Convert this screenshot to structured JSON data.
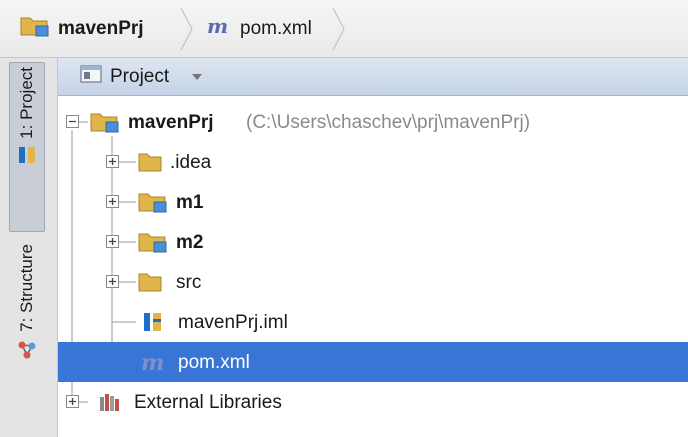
{
  "breadcrumb": {
    "items": [
      {
        "label": "mavenPrj",
        "icon": "module-folder-icon"
      },
      {
        "label": "pom.xml",
        "icon": "maven-m-icon"
      }
    ]
  },
  "tool_stripe": {
    "tabs": [
      {
        "label": "1: Project",
        "icon": "intellij-module-icon",
        "active": true
      },
      {
        "label": "7: Structure",
        "icon": "structure-icon",
        "active": false
      }
    ]
  },
  "panel": {
    "view_label": "Project",
    "view_icon": "project-view-icon"
  },
  "tree": {
    "root": {
      "label": "mavenPrj",
      "path": "(C:\\Users\\chaschev\\prj\\mavenPrj)",
      "icon": "module-folder-icon",
      "expanded": true
    },
    "children": [
      {
        "label": ".idea",
        "icon": "folder-icon",
        "bold": false,
        "expandable": true
      },
      {
        "label": "m1",
        "icon": "module-folder-icon",
        "bold": true,
        "expandable": true
      },
      {
        "label": "m2",
        "icon": "module-folder-icon",
        "bold": true,
        "expandable": true
      },
      {
        "label": "src",
        "icon": "folder-icon",
        "bold": false,
        "expandable": true
      },
      {
        "label": "mavenPrj.iml",
        "icon": "iml-file-icon",
        "bold": false,
        "expandable": false
      },
      {
        "label": "pom.xml",
        "icon": "maven-m-icon",
        "bold": false,
        "expandable": false,
        "selected": true
      }
    ],
    "external": {
      "label": "External Libraries",
      "icon": "library-icon",
      "expandable": true
    }
  },
  "colors": {
    "selection": "#3875d7",
    "folder": "#e0b54a",
    "module_badge": "#4a8fd6",
    "maven_m": "#5b6bb4"
  }
}
